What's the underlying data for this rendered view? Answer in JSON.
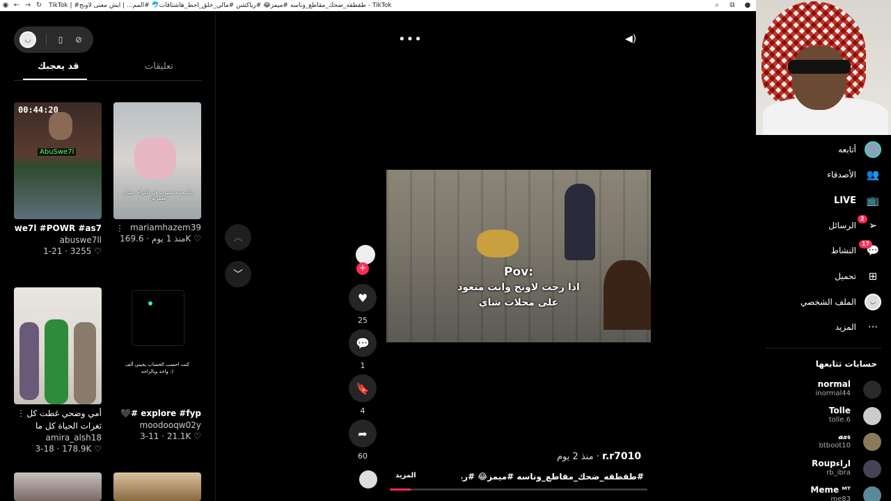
{
  "browser": {
    "title": "TikTok | #طقطقه_ضحك_مقاطع_وناسه #ميمز😂 #رياكشن #مالي_خلق_احط_هاشتاقات🐬 #المم... | ايش معنى لاونج - TikTok",
    "icons": [
      "back-icon",
      "forward-icon",
      "reload-icon",
      "zoom-icon",
      "extensions-icon",
      "profile-icon"
    ]
  },
  "left_panel": {
    "tabs": {
      "comments": "تعليقات",
      "you_may_like": "قد يعجبك"
    },
    "cards": [
      {
        "caption": "Kick : AbuSwe7l #POWR #as7...",
        "user": "abuswe7ll",
        "likes": "3255",
        "date": "1-21",
        "thumb_text": "00:44:20",
        "thumb_sub": "AbuSwe7l"
      },
      {
        "caption": "",
        "user": "mariamhazem39",
        "likes": "169.6K",
        "date": "منذ 1 يوم",
        "thumb_text": "بابا بعد ما بشرت في الكراج عشان مفقرش"
      },
      {
        "caption": "أمي وضحي غطت كل ثغرات الحياة كل ما نقصت...",
        "user": "amira_alsh18",
        "likes": "178.9K",
        "date": "3-18"
      },
      {
        "caption": "explore #fyp #🖤",
        "user": "moodooqw02y",
        "likes": "21.1K",
        "date": "3-11",
        "thumb_text": "كنت احسب الحساب يجيني ألف واحد وبالراحه :)"
      }
    ]
  },
  "video": {
    "overlay_line1": "Pov:",
    "overlay_line2": "اذا رحت لاونج وانت متعود",
    "overlay_line3": "على محلات شاي",
    "author": "r.r7010",
    "posted": "منذ 2 يوم",
    "description": "#طقطقه_ضحك_مقاطع_وناسه #ميمز😂 #رياكشن ...",
    "more_label": "المزيد",
    "progress": 0.08,
    "likes": "25",
    "comments": "1",
    "saves": "4",
    "shares": "60"
  },
  "right_nav": {
    "items": [
      {
        "label": "أتابعه",
        "icon": "following-avatar-icon"
      },
      {
        "label": "الأصدقاء",
        "icon": "friends-icon"
      },
      {
        "label": "LIVE",
        "icon": "live-icon"
      },
      {
        "label": "الرسائل",
        "icon": "messages-icon",
        "badge": "2"
      },
      {
        "label": "النشاط",
        "icon": "activity-icon",
        "badge": "17"
      },
      {
        "label": "تحميل",
        "icon": "upload-icon"
      },
      {
        "label": "الملف الشخصي",
        "icon": "profile-avatar-icon"
      },
      {
        "label": "المزيد",
        "icon": "more-icon"
      }
    ],
    "following_title": "حسابات تتابعها",
    "accounts": [
      {
        "name": "normal",
        "handle": "inormal44"
      },
      {
        "name": "Tolle",
        "handle": "tolle.6"
      },
      {
        "name": "𝒶𝓍𝓇",
        "handle": "btboot10"
      },
      {
        "name": "Roupاراء",
        "handle": "rb_ibra"
      },
      {
        "name": "Meme ᴹᵀ",
        "handle": "me83"
      }
    ]
  },
  "colors": {
    "accent": "#fe2c55",
    "background": "#000000",
    "panel": "#252525"
  }
}
